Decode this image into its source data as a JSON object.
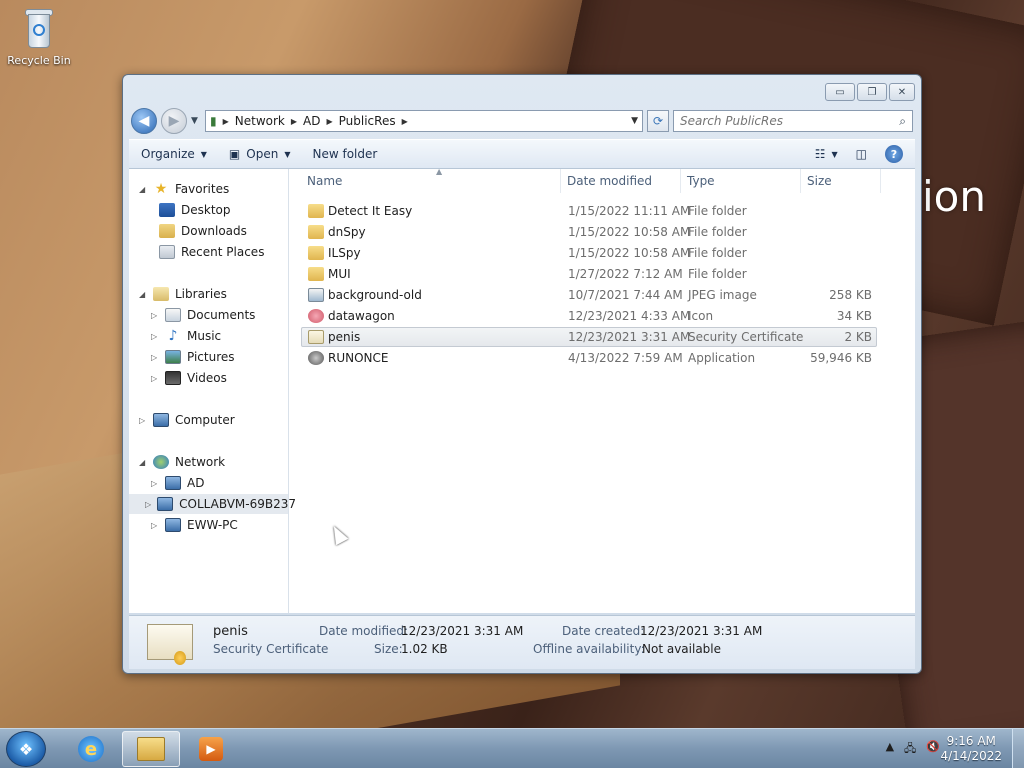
{
  "desktop": {
    "recycle_bin_label": "Recycle Bin",
    "bg_text": "ion"
  },
  "window": {
    "caption_buttons": {
      "minimize": "▭",
      "maximize": "❐",
      "close": "✕"
    },
    "navigation": {
      "back_icon": "back-arrow-icon",
      "forward_icon": "forward-arrow-icon",
      "address_crumbs": [
        "Network",
        "AD",
        "PublicRes"
      ],
      "search_placeholder": "Search PublicRes"
    },
    "command_bar": {
      "organize": "Organize",
      "open": "Open",
      "new_folder": "New folder"
    },
    "nav_pane": {
      "favorites": "Favorites",
      "favorites_items": [
        "Desktop",
        "Downloads",
        "Recent Places"
      ],
      "libraries": "Libraries",
      "libraries_items": [
        "Documents",
        "Music",
        "Pictures",
        "Videos"
      ],
      "computer": "Computer",
      "network": "Network",
      "network_items": [
        "AD",
        "COLLABVM-69B237",
        "EWW-PC"
      ],
      "selected": "COLLABVM-69B237"
    },
    "columns": [
      "Name",
      "Date modified",
      "Type",
      "Size"
    ],
    "files": [
      {
        "name": "Detect It Easy",
        "date": "1/15/2022 11:11 AM",
        "type": "File folder",
        "size": "",
        "icon": "folder-icon"
      },
      {
        "name": "dnSpy",
        "date": "1/15/2022 10:58 AM",
        "type": "File folder",
        "size": "",
        "icon": "folder-icon"
      },
      {
        "name": "ILSpy",
        "date": "1/15/2022 10:58 AM",
        "type": "File folder",
        "size": "",
        "icon": "folder-icon"
      },
      {
        "name": "MUI",
        "date": "1/27/2022 7:12 AM",
        "type": "File folder",
        "size": "",
        "icon": "folder-icon"
      },
      {
        "name": "background-old",
        "date": "10/7/2021 7:44 AM",
        "type": "JPEG image",
        "size": "258 KB",
        "icon": "image-file-icon"
      },
      {
        "name": "datawagon",
        "date": "12/23/2021 4:33 AM",
        "type": "Icon",
        "size": "34 KB",
        "icon": "ico-file-icon"
      },
      {
        "name": "penis",
        "date": "12/23/2021 3:31 AM",
        "type": "Security Certificate",
        "size": "2 KB",
        "icon": "certificate-icon"
      },
      {
        "name": "RUNONCE",
        "date": "4/13/2022 7:59 AM",
        "type": "Application",
        "size": "59,946 KB",
        "icon": "application-icon"
      }
    ],
    "selected_file": "penis",
    "details": {
      "name": "penis",
      "type": "Security Certificate",
      "date_modified_label": "Date modified:",
      "date_modified": "12/23/2021 3:31 AM",
      "size_label": "Size:",
      "size": "1.02 KB",
      "date_created_label": "Date created:",
      "date_created": "12/23/2021 3:31 AM",
      "offline_label": "Offline availability:",
      "offline": "Not available"
    }
  },
  "taskbar": {
    "time": "9:16 AM",
    "date": "4/14/2022"
  }
}
